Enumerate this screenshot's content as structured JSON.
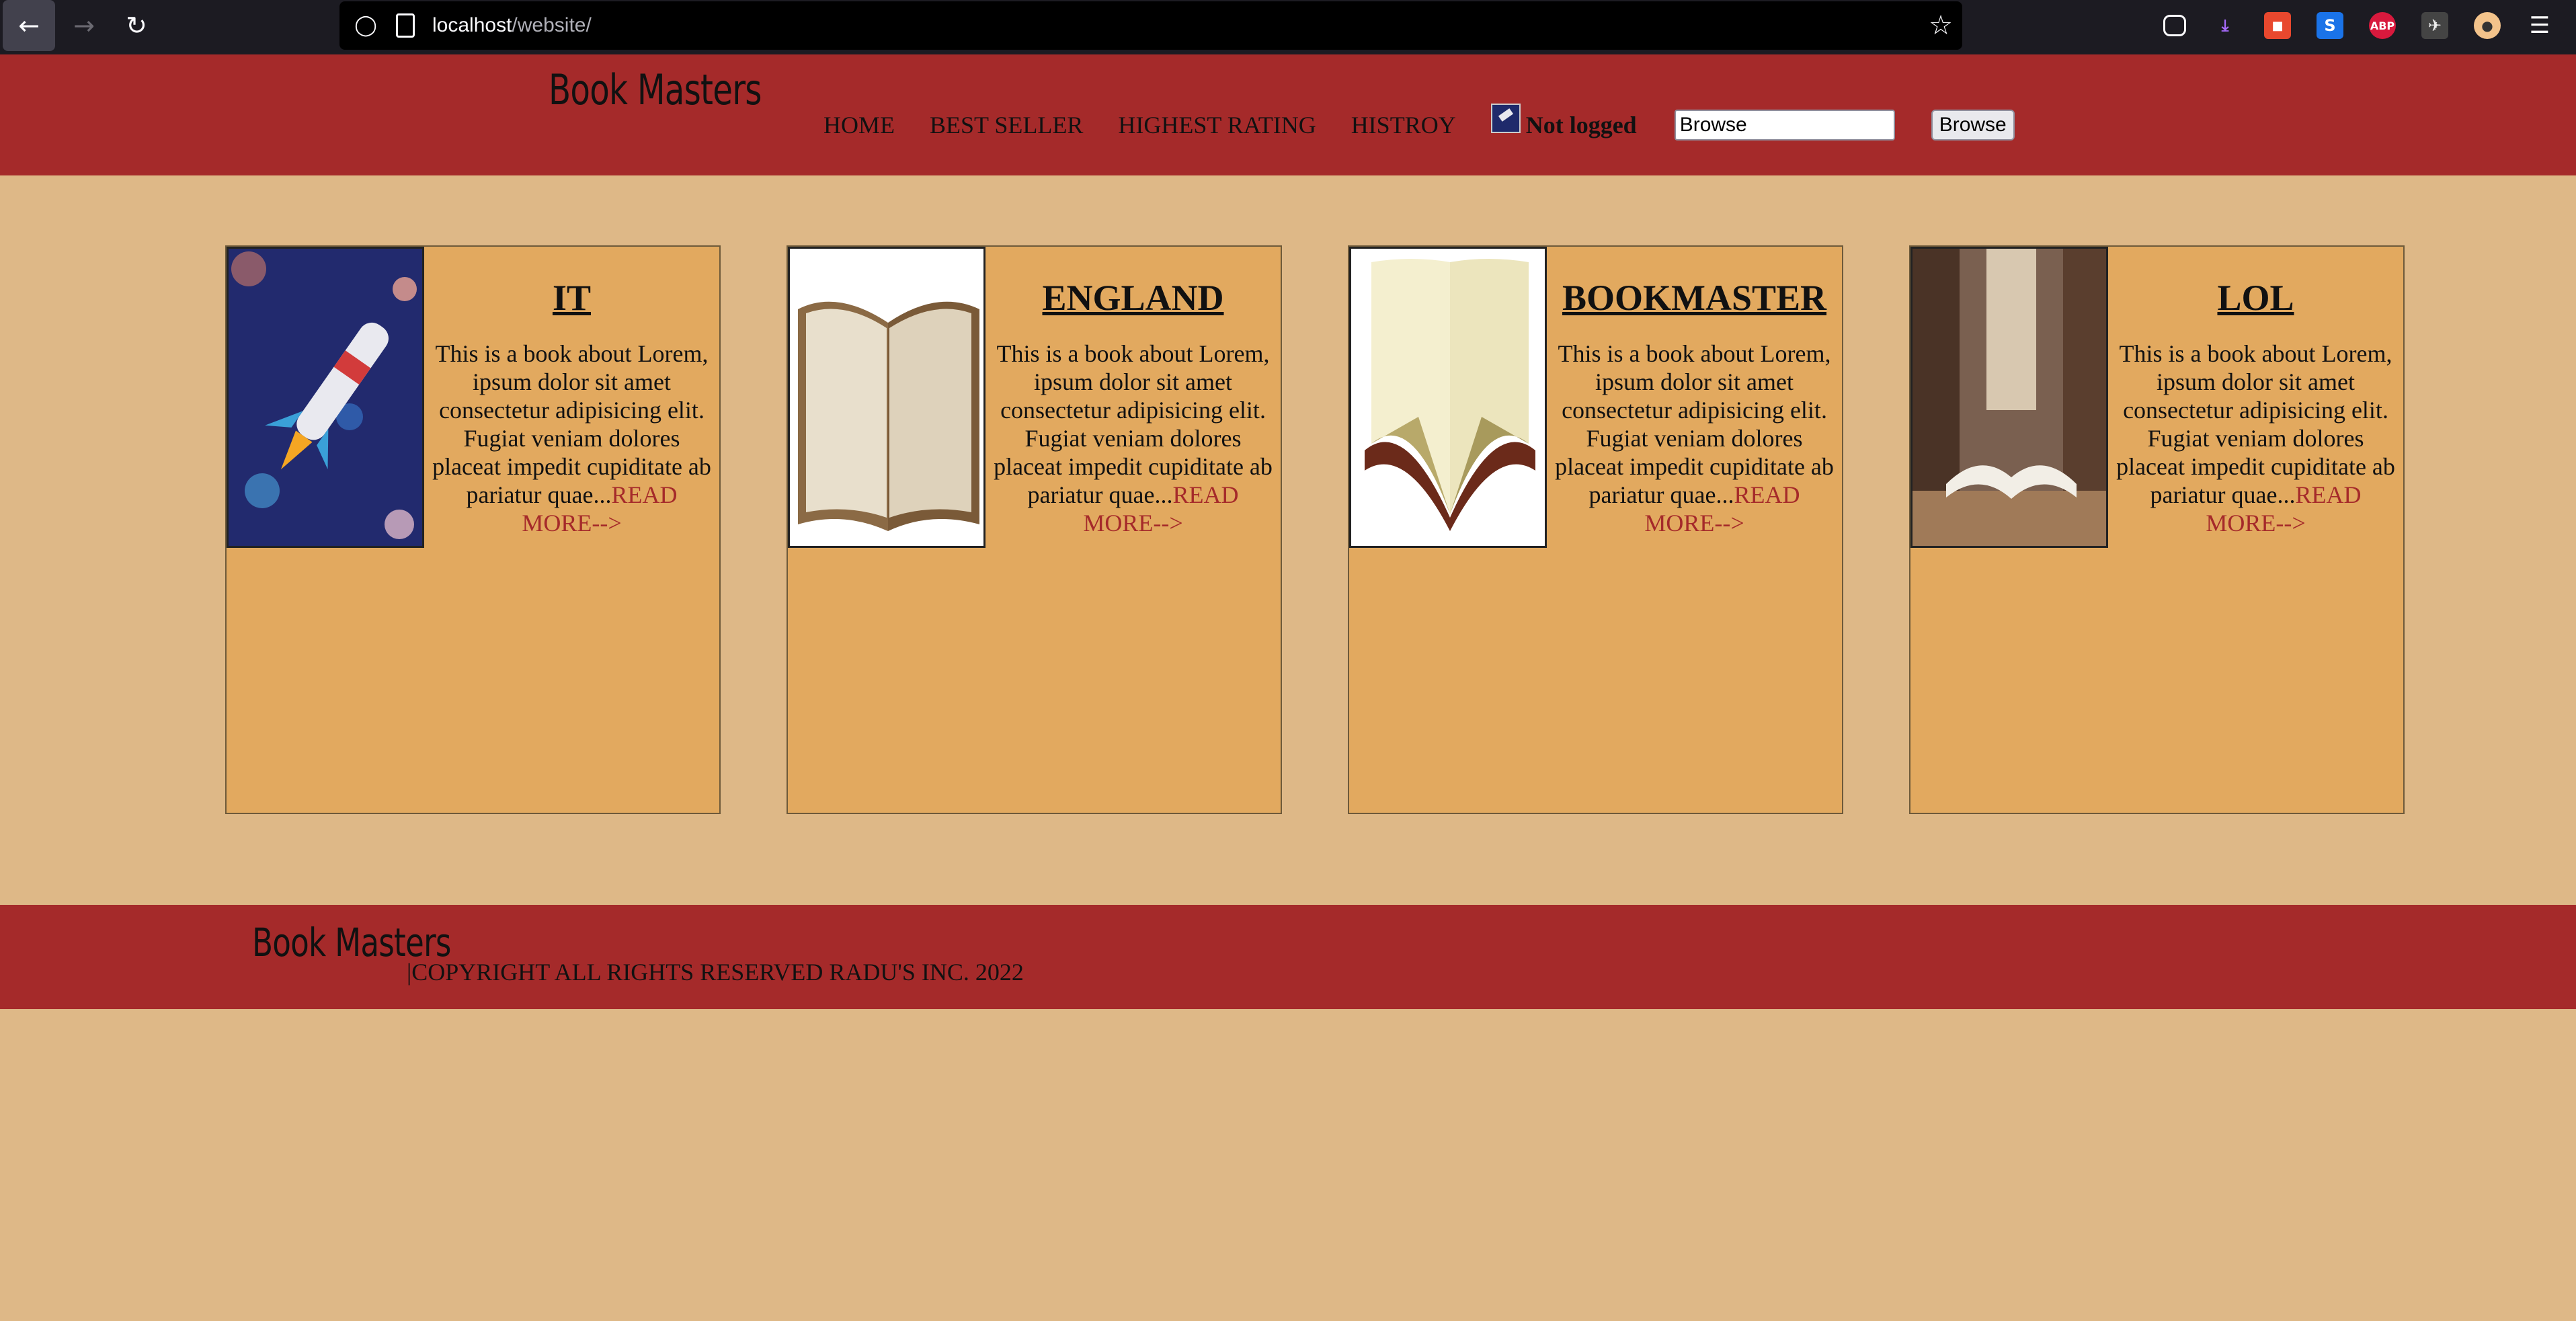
{
  "browser": {
    "url_host": "localhost",
    "url_path": "/website/",
    "icons": [
      "back-icon",
      "forward-icon",
      "reload-icon",
      "shield-icon",
      "page-icon",
      "star-icon",
      "pocket-icon",
      "download-icon",
      "extension-icon",
      "s-extension-icon",
      "adblock-icon",
      "extension-icon-2",
      "profile-icon",
      "menu-icon"
    ]
  },
  "header": {
    "brand": "Book Masters",
    "nav": [
      "HOME",
      "BEST SELLER",
      "HIGHEST RATING",
      "HISTROY"
    ],
    "login_status": "Not logged",
    "search_value": "Browse",
    "browse_button": "Browse"
  },
  "cards": [
    {
      "title": "IT",
      "text": "This is a book about Lorem, ipsum dolor sit amet consectetur adipisicing elit. Fugiat veniam dolores placeat impedit cupiditate ab pariatur quae...",
      "read_more": "READ MORE-->"
    },
    {
      "title": "ENGLAND",
      "text": "This is a book about Lorem, ipsum dolor sit amet consectetur adipisicing elit. Fugiat veniam dolores placeat impedit cupiditate ab pariatur quae...",
      "read_more": "READ MORE-->"
    },
    {
      "title": "BOOKMASTER",
      "text": "This is a book about Lorem, ipsum dolor sit amet consectetur adipisicing elit. Fugiat veniam dolores placeat impedit cupiditate ab pariatur quae...",
      "read_more": "READ MORE-->"
    },
    {
      "title": "LOL",
      "text": "This is a book about Lorem, ipsum dolor sit amet consectetur adipisicing elit. Fugiat veniam dolores placeat impedit cupiditate ab pariatur quae...",
      "read_more": "READ MORE-->"
    }
  ],
  "footer": {
    "brand": "Book Masters",
    "copyright": "|COPYRIGHT ALL RIGHTS RESERVED RADU'S INC. 2022"
  },
  "colors": {
    "header_bg": "#a52a2a",
    "page_bg": "#deb887",
    "card_bg": "#e2a95f",
    "link": "#a52a2a"
  }
}
